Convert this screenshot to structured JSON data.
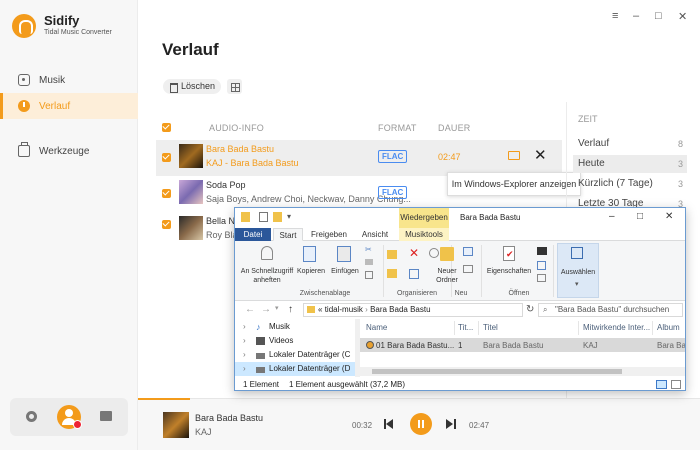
{
  "app": {
    "name": "Sidify",
    "subtitle": "Tidal Music Converter",
    "accent_color": "#f39b1b"
  },
  "window_controls": {
    "menu": "≡",
    "minimize": "–",
    "maximize": "□",
    "close": "✕"
  },
  "sidebar": {
    "items": [
      {
        "label": "Musik",
        "icon": "music-icon",
        "active": false
      },
      {
        "label": "Verlauf",
        "icon": "clock-icon",
        "active": true
      },
      {
        "label": "Werkzeuge",
        "icon": "toolbox-icon",
        "active": false
      }
    ]
  },
  "main": {
    "title": "Verlauf",
    "delete_label": "Löschen",
    "columns": {
      "info": "AUDIO-INFO",
      "format": "FORMAT",
      "duration": "DAUER"
    },
    "tracks": [
      {
        "title": "Bara Bada Bastu",
        "artist": "KAJ - Bara Bada Bastu",
        "format": "FLAC",
        "duration": "02:47",
        "selected": true
      },
      {
        "title": "Soda Pop",
        "artist": "Saja Boys, Andrew Choi, Neckwav, Danny Chung...",
        "format": "FLAC",
        "duration": "",
        "selected": false
      },
      {
        "title": "Bella N",
        "artist": "Roy Bla",
        "format": "",
        "duration": "",
        "selected": false
      }
    ],
    "tooltip": "Im Windows-Explorer anzeigen"
  },
  "time_panel": {
    "header": "ZEIT",
    "items": [
      {
        "label": "Verlauf",
        "count": "8"
      },
      {
        "label": "Heute",
        "count": "3"
      },
      {
        "label": "Kürzlich (7 Tage)",
        "count": "3"
      },
      {
        "label": "Letzte 30 Tage",
        "count": "3"
      }
    ]
  },
  "player": {
    "title": "Bara Bada Bastu",
    "artist": "KAJ",
    "elapsed": "00:32",
    "total": "02:47"
  },
  "explorer": {
    "title": "Bara Bada Bastu",
    "context_tab": "Wiedergeben",
    "tabs": [
      "Datei",
      "Start",
      "Freigeben",
      "Ansicht",
      "Musiktools"
    ],
    "ribbon": {
      "pin_label": "An Schnellzugriff anheften",
      "copy_label": "Kopieren",
      "paste_label": "Einfügen",
      "group_clipboard": "Zwischenablage",
      "group_organize": "Organisieren",
      "new_folder_label": "Neuer Ordner",
      "group_new": "Neu",
      "properties_label": "Eigenschaften",
      "group_open": "Öffnen",
      "select_label": "Auswählen"
    },
    "address": {
      "prefix": "«",
      "crumb1": "tidal-musik",
      "crumb2": "Bara Bada Bastu"
    },
    "search_placeholder": "\"Bara Bada Bastu\" durchsuchen",
    "tree": [
      {
        "label": "Musik"
      },
      {
        "label": "Videos"
      },
      {
        "label": "Lokaler Datenträger (C"
      },
      {
        "label": "Lokaler Datenträger (D"
      }
    ],
    "columns": {
      "name": "Name",
      "track": "Tit...",
      "title": "Titel",
      "artists": "Mitwirkende Inter...",
      "album": "Album"
    },
    "files": [
      {
        "name": "01 Bara Bada Bastu....",
        "track": "1",
        "title": "Bara Bada Bastu",
        "artists": "KAJ",
        "album": "Bara Bada Bastu"
      }
    ],
    "status": {
      "count": "1 Element",
      "selected": "1 Element ausgewählt (37,2 MB)"
    }
  }
}
